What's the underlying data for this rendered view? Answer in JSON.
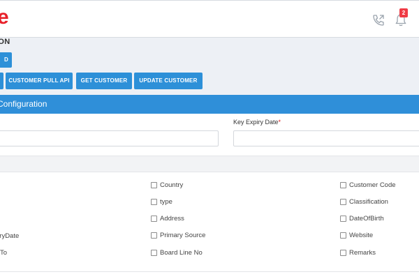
{
  "header": {
    "logo_text": "e",
    "notification_count": "2",
    "icons": [
      "phone-call-icon",
      "bell-icon"
    ],
    "logo_color": "#e8202a",
    "badge_color": "#ef3b45"
  },
  "page": {
    "heading": "ION",
    "top_button_label": "D"
  },
  "toolbar": {
    "buttons": [
      "CUSTOMER PULL API",
      "GET CUSTOMER",
      "UPDATE CUSTOMER"
    ],
    "accent_color": "#2d90d8"
  },
  "config": {
    "title": "Configuration",
    "key_expiry_label": "Key Expiry Date",
    "required_mark": "*",
    "left_input_value": "",
    "right_input_value": ""
  },
  "fields": {
    "left_column": [
      "aryDate",
      "To"
    ],
    "middle_column": [
      "Country",
      "type",
      "Address",
      "Primary Source",
      "Board Line No"
    ],
    "right_column": [
      "Customer Code",
      "Classification",
      "DateOfBirth",
      "Website",
      "Remarks"
    ]
  }
}
